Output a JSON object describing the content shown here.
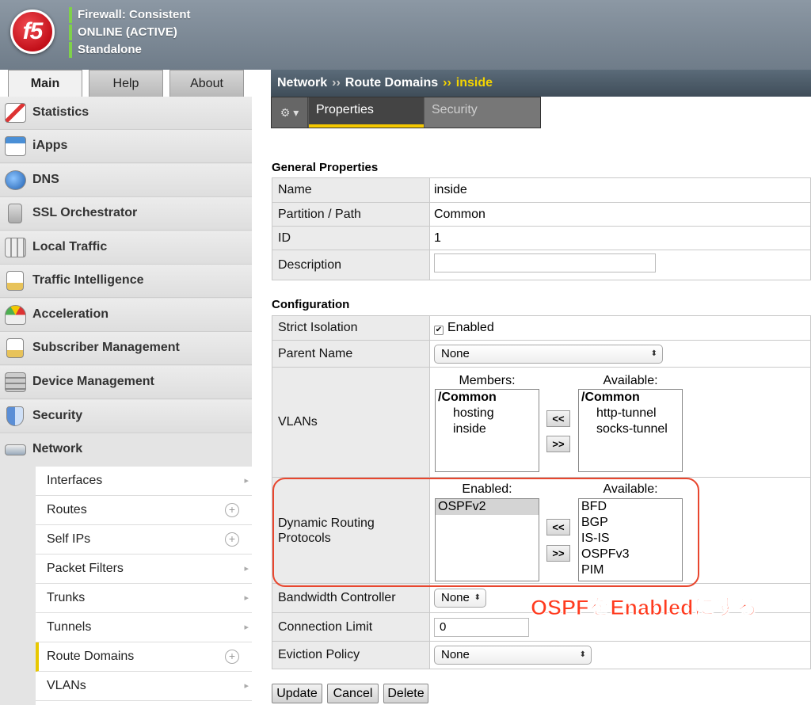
{
  "header": {
    "status": [
      "Firewall: Consistent",
      "ONLINE (ACTIVE)",
      "Standalone"
    ],
    "logo_text": "f5"
  },
  "tabs": [
    "Main",
    "Help",
    "About"
  ],
  "sidebar": {
    "items": [
      {
        "label": "Statistics",
        "icon": "statistics-icon"
      },
      {
        "label": "iApps",
        "icon": "iapps-icon"
      },
      {
        "label": "DNS",
        "icon": "globe-icon"
      },
      {
        "label": "SSL Orchestrator",
        "icon": "lock-icon"
      },
      {
        "label": "Local Traffic",
        "icon": "servers-icon"
      },
      {
        "label": "Traffic Intelligence",
        "icon": "clipboard-icon"
      },
      {
        "label": "Acceleration",
        "icon": "gauge-icon"
      },
      {
        "label": "Subscriber Management",
        "icon": "checklist-icon"
      },
      {
        "label": "Device Management",
        "icon": "device-icon"
      },
      {
        "label": "Security",
        "icon": "shield-icon"
      },
      {
        "label": "Network",
        "icon": "network-icon"
      }
    ],
    "subitems": [
      {
        "label": "Interfaces",
        "action": "chevron"
      },
      {
        "label": "Routes",
        "action": "plus"
      },
      {
        "label": "Self IPs",
        "action": "plus"
      },
      {
        "label": "Packet Filters",
        "action": "chevron"
      },
      {
        "label": "Trunks",
        "action": "chevron"
      },
      {
        "label": "Tunnels",
        "action": "chevron"
      },
      {
        "label": "Route Domains",
        "action": "plus"
      },
      {
        "label": "VLANs",
        "action": "chevron"
      }
    ]
  },
  "breadcrumb": {
    "part1": "Network",
    "sep": "››",
    "part2": "Route Domains",
    "current": "inside"
  },
  "subtabs": {
    "gear": "⚙ ▾",
    "properties": "Properties",
    "security": "Security"
  },
  "general": {
    "heading": "General Properties",
    "rows": [
      {
        "key": "Name",
        "value": "inside"
      },
      {
        "key": "Partition / Path",
        "value": "Common"
      },
      {
        "key": "ID",
        "value": "1"
      },
      {
        "key": "Description",
        "value": ""
      }
    ]
  },
  "config": {
    "heading": "Configuration",
    "strict_isolation": {
      "key": "Strict Isolation",
      "value": "Enabled"
    },
    "parent_name": {
      "key": "Parent Name",
      "value": "None"
    },
    "vlans": {
      "key": "VLANs",
      "members_label": "Members:",
      "available_label": "Available:",
      "members": [
        "/Common",
        "hosting",
        "inside"
      ],
      "available": [
        "/Common",
        "http-tunnel",
        "socks-tunnel"
      ]
    },
    "routing": {
      "key_line1": "Dynamic Routing",
      "key_line2": "Protocols",
      "enabled_label": "Enabled:",
      "available_label": "Available:",
      "enabled": [
        "OSPFv2"
      ],
      "available": [
        "BFD",
        "BGP",
        "IS-IS",
        "OSPFv3",
        "PIM"
      ]
    },
    "move_left": "<<",
    "move_right": ">>",
    "bandwidth": {
      "key": "Bandwidth Controller",
      "value": "None"
    },
    "connection_limit": {
      "key": "Connection Limit",
      "value": "0"
    },
    "eviction": {
      "key": "Eviction Policy",
      "value": "None"
    }
  },
  "annotation": "OSPFをEnabledにする",
  "buttons": {
    "update": "Update",
    "cancel": "Cancel",
    "delete": "Delete"
  },
  "colors": {
    "accent": "#f4c800",
    "annotation": "#ff3b1f",
    "status_bar": "#7fd14a"
  }
}
